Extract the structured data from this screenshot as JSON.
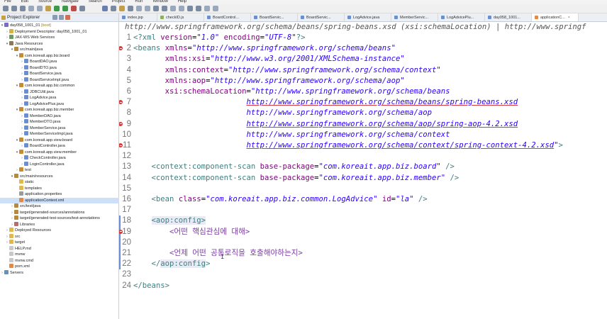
{
  "menubar": [
    "File",
    "Edit",
    "Source",
    "Navigate",
    "Search",
    "Project",
    "Run",
    "Window",
    "Help"
  ],
  "project_explorer": {
    "title": "Project Explorer",
    "tree": [
      {
        "label": "day058_1001_01",
        "suffix": " [boot]",
        "indent": 0,
        "arrow": "▾",
        "icon": "project-icon",
        "cls": "ic-proj"
      },
      {
        "label": "Deployment Descriptor: day058_1001_01",
        "indent": 1,
        "arrow": "›",
        "icon": "deployment-descriptor-icon",
        "cls": "ic-dd"
      },
      {
        "label": "JAX-WS Web Services",
        "indent": 1,
        "arrow": "›",
        "icon": "jaxws-icon",
        "cls": "ic-jaxws"
      },
      {
        "label": "Java Resources",
        "indent": 1,
        "arrow": "▾",
        "icon": "java-resources-icon",
        "cls": "ic-jres"
      },
      {
        "label": "src/main/java",
        "indent": 2,
        "arrow": "▾",
        "icon": "source-folder-icon",
        "cls": "ic-src"
      },
      {
        "label": "com.koreait.app.biz.board",
        "indent": 3,
        "arrow": "▾",
        "icon": "package-icon",
        "cls": "ic-pkg"
      },
      {
        "label": "BoardDAO.java",
        "indent": 4,
        "arrow": "›",
        "icon": "java-file-icon",
        "cls": "ic-java"
      },
      {
        "label": "BoardDTO.java",
        "indent": 4,
        "arrow": "›",
        "icon": "java-file-icon",
        "cls": "ic-java"
      },
      {
        "label": "BoardService.java",
        "indent": 4,
        "arrow": "›",
        "icon": "java-file-icon",
        "cls": "ic-java"
      },
      {
        "label": "BoardServiceImpl.java",
        "indent": 4,
        "arrow": "›",
        "icon": "java-file-icon",
        "cls": "ic-java"
      },
      {
        "label": "com.koreait.app.biz.common",
        "indent": 3,
        "arrow": "▾",
        "icon": "package-icon",
        "cls": "ic-pkg"
      },
      {
        "label": "JDBCUtil.java",
        "indent": 4,
        "arrow": "›",
        "icon": "java-file-icon",
        "cls": "ic-java"
      },
      {
        "label": "LogAdvice.java",
        "indent": 4,
        "arrow": "›",
        "icon": "java-file-icon",
        "cls": "ic-java"
      },
      {
        "label": "LogAdvicePlus.java",
        "indent": 4,
        "arrow": "›",
        "icon": "java-file-icon",
        "cls": "ic-java"
      },
      {
        "label": "com.koreait.app.biz.member",
        "indent": 3,
        "arrow": "▾",
        "icon": "package-icon",
        "cls": "ic-pkg"
      },
      {
        "label": "MemberDAO.java",
        "indent": 4,
        "arrow": "›",
        "icon": "java-file-icon",
        "cls": "ic-java"
      },
      {
        "label": "MemberDTO.java",
        "indent": 4,
        "arrow": "›",
        "icon": "java-file-icon",
        "cls": "ic-java"
      },
      {
        "label": "MemberService.java",
        "indent": 4,
        "arrow": "›",
        "icon": "java-file-icon",
        "cls": "ic-java"
      },
      {
        "label": "MemberServiceImpl.java",
        "indent": 4,
        "arrow": "›",
        "icon": "java-file-icon",
        "cls": "ic-java"
      },
      {
        "label": "com.koreait.app.view.board",
        "indent": 3,
        "arrow": "▾",
        "icon": "package-icon",
        "cls": "ic-pkg"
      },
      {
        "label": "BoardController.java",
        "indent": 4,
        "arrow": "›",
        "icon": "java-file-icon",
        "cls": "ic-java"
      },
      {
        "label": "com.koreait.app.view.member",
        "indent": 3,
        "arrow": "▾",
        "icon": "package-icon",
        "cls": "ic-pkg"
      },
      {
        "label": "CheckController.java",
        "indent": 4,
        "arrow": "›",
        "icon": "java-file-icon",
        "cls": "ic-java"
      },
      {
        "label": "LoginController.java",
        "indent": 4,
        "arrow": "›",
        "icon": "java-file-icon",
        "cls": "ic-java"
      },
      {
        "label": "test",
        "indent": 3,
        "arrow": "›",
        "icon": "package-icon",
        "cls": "ic-pkg"
      },
      {
        "label": "src/main/resources",
        "indent": 2,
        "arrow": "▾",
        "icon": "source-folder-icon",
        "cls": "ic-src"
      },
      {
        "label": "static",
        "indent": 3,
        "arrow": "",
        "icon": "folder-icon",
        "cls": "ic-fold"
      },
      {
        "label": "templates",
        "indent": 3,
        "arrow": "",
        "icon": "folder-icon",
        "cls": "ic-fold"
      },
      {
        "label": "application.properties",
        "indent": 3,
        "arrow": "",
        "icon": "properties-file-icon",
        "cls": "ic-prop"
      },
      {
        "label": "applicationContext.xml",
        "indent": 3,
        "arrow": "",
        "icon": "xml-file-icon",
        "cls": "ic-xml",
        "selected": true
      },
      {
        "label": "src/test/java",
        "indent": 2,
        "arrow": "›",
        "icon": "source-folder-icon",
        "cls": "ic-src"
      },
      {
        "label": "target/generated-sources/annotations",
        "indent": 2,
        "arrow": "›",
        "icon": "source-folder-icon",
        "cls": "ic-src"
      },
      {
        "label": "target/generated-test-sources/test-annotations",
        "indent": 2,
        "arrow": "›",
        "icon": "source-folder-icon",
        "cls": "ic-src"
      },
      {
        "label": "Libraries",
        "indent": 2,
        "arrow": "›",
        "icon": "libraries-icon",
        "cls": "ic-lib"
      },
      {
        "label": "Deployed Resources",
        "indent": 1,
        "arrow": "›",
        "icon": "folder-icon",
        "cls": "ic-fold"
      },
      {
        "label": "src",
        "indent": 1,
        "arrow": "›",
        "icon": "folder-icon",
        "cls": "ic-fold"
      },
      {
        "label": "target",
        "indent": 1,
        "arrow": "›",
        "icon": "folder-icon",
        "cls": "ic-fold"
      },
      {
        "label": "HELP.md",
        "indent": 1,
        "arrow": "",
        "icon": "file-icon",
        "cls": "ic-file"
      },
      {
        "label": "mvnw",
        "indent": 1,
        "arrow": "",
        "icon": "file-icon",
        "cls": "ic-file"
      },
      {
        "label": "mvnw.cmd",
        "indent": 1,
        "arrow": "",
        "icon": "file-icon",
        "cls": "ic-file"
      },
      {
        "label": "pom.xml",
        "indent": 1,
        "arrow": "",
        "icon": "xml-file-icon",
        "cls": "ic-xml"
      },
      {
        "label": "Servers",
        "indent": 0,
        "arrow": "›",
        "icon": "servers-icon",
        "cls": "ic-srv"
      }
    ]
  },
  "tabs": [
    {
      "label": "index.jsp",
      "kind": "java"
    },
    {
      "label": "checkID.js",
      "kind": "js"
    },
    {
      "label": "BoardControl...",
      "kind": "java"
    },
    {
      "label": "BoardServic...",
      "kind": "java"
    },
    {
      "label": "BoardServic...",
      "kind": "java"
    },
    {
      "label": "LogAdvice.java",
      "kind": "java"
    },
    {
      "label": "MemberServic...",
      "kind": "java"
    },
    {
      "label": "LogAdvicePlu...",
      "kind": "java"
    },
    {
      "label": "day058_1001...",
      "kind": "java"
    },
    {
      "label": "applicationC...",
      "kind": "xml",
      "active": true
    }
  ],
  "editor": {
    "hover_header": "http://www.springframework.org/schema/beans/spring-beans.xsd (xsi:schemaLocation) | http://www.springf",
    "lines": [
      {
        "n": "1",
        "err": false,
        "fold": "",
        "parts": [
          [
            "pi",
            "<?xml "
          ],
          [
            "attr",
            "version"
          ],
          [
            "txt",
            "="
          ],
          [
            "val",
            "\"1.0\""
          ],
          [
            "txt",
            " "
          ],
          [
            "attr",
            "encoding"
          ],
          [
            "txt",
            "="
          ],
          [
            "val",
            "\"UTF-8\""
          ],
          [
            "pi",
            "?>"
          ]
        ]
      },
      {
        "n": "2",
        "err": true,
        "fold": "⊖",
        "parts": [
          [
            "tag",
            "<beans "
          ],
          [
            "attr",
            "xmlns"
          ],
          [
            "txt",
            "="
          ],
          [
            "val",
            "\"http://www.springframework.org/schema/beans\""
          ]
        ]
      },
      {
        "n": "3",
        "err": false,
        "fold": "",
        "parts": [
          [
            "txt",
            "       "
          ],
          [
            "attr",
            "xmlns:xsi"
          ],
          [
            "txt",
            "="
          ],
          [
            "val",
            "\"http://www.w3.org/2001/XMLSchema-instance\""
          ]
        ]
      },
      {
        "n": "4",
        "err": false,
        "fold": "",
        "parts": [
          [
            "txt",
            "       "
          ],
          [
            "attr",
            "xmlns:context"
          ],
          [
            "txt",
            "="
          ],
          [
            "val",
            "\"http://www.springframework.org/schema/context\""
          ]
        ]
      },
      {
        "n": "5",
        "err": false,
        "fold": "",
        "parts": [
          [
            "txt",
            "       "
          ],
          [
            "attr",
            "xmlns:aop"
          ],
          [
            "txt",
            "="
          ],
          [
            "val",
            "\"http://www.springframework.org/schema/aop\""
          ]
        ]
      },
      {
        "n": "6",
        "err": false,
        "fold": "",
        "parts": [
          [
            "txt",
            "       "
          ],
          [
            "attr",
            "xsi:schemaLocation"
          ],
          [
            "txt",
            "="
          ],
          [
            "val",
            "\"http://www.springframework.org/schema/beans"
          ]
        ]
      },
      {
        "n": "7",
        "err": true,
        "fold": "",
        "parts": [
          [
            "txt",
            "                         "
          ],
          [
            "val und",
            "http://www.springframework.org/schema/beans/spring-beans.xsd"
          ]
        ]
      },
      {
        "n": "8",
        "err": false,
        "fold": "",
        "parts": [
          [
            "txt",
            "                         "
          ],
          [
            "val",
            "http://www.springframework.org/schema/aop"
          ]
        ]
      },
      {
        "n": "9",
        "err": true,
        "fold": "",
        "parts": [
          [
            "txt",
            "                         "
          ],
          [
            "val und",
            "http://www.springframework.org/schema/aop/spring-aop-4.2.xsd"
          ]
        ]
      },
      {
        "n": "10",
        "err": false,
        "fold": "",
        "parts": [
          [
            "txt",
            "                         "
          ],
          [
            "val",
            "http://www.springframework.org/schema/context"
          ]
        ]
      },
      {
        "n": "11",
        "err": true,
        "fold": "",
        "parts": [
          [
            "txt",
            "                         "
          ],
          [
            "val und",
            "http://www.springframework.org/schema/context/spring-context-4.2.xsd"
          ],
          [
            "val",
            "\""
          ],
          [
            "tag",
            ">"
          ]
        ]
      },
      {
        "n": "12",
        "err": false,
        "fold": "",
        "parts": []
      },
      {
        "n": "13",
        "err": false,
        "fold": "",
        "parts": [
          [
            "txt",
            "    "
          ],
          [
            "tag",
            "<context:component-scan "
          ],
          [
            "attr",
            "base-package"
          ],
          [
            "txt",
            "="
          ],
          [
            "val",
            "\"com.koreait.app.biz.board\""
          ],
          [
            "tag",
            " />"
          ]
        ]
      },
      {
        "n": "14",
        "err": false,
        "fold": "",
        "parts": [
          [
            "txt",
            "    "
          ],
          [
            "tag",
            "<context:component-scan "
          ],
          [
            "attr",
            "base-package"
          ],
          [
            "txt",
            "="
          ],
          [
            "val",
            "\"com.koreait.app.biz.member\""
          ],
          [
            "tag",
            " />"
          ]
        ]
      },
      {
        "n": "15",
        "err": false,
        "fold": "",
        "parts": []
      },
      {
        "n": "16",
        "err": false,
        "fold": "",
        "parts": [
          [
            "txt",
            "    "
          ],
          [
            "tag",
            "<bean "
          ],
          [
            "attr",
            "class"
          ],
          [
            "txt",
            "="
          ],
          [
            "val",
            "\"com.koreait.app.biz.common.LogAdvice\""
          ],
          [
            "txt",
            " "
          ],
          [
            "attr",
            "id"
          ],
          [
            "txt",
            "="
          ],
          [
            "val",
            "\"la\""
          ],
          [
            "tag",
            " />"
          ]
        ]
      },
      {
        "n": "17",
        "err": false,
        "fold": "",
        "parts": []
      },
      {
        "n": "18",
        "err": false,
        "fold": "⊖",
        "sel": true,
        "parts": [
          [
            "txt",
            "    "
          ],
          [
            "tag hl",
            "<aop:config>"
          ]
        ]
      },
      {
        "n": "19",
        "err": true,
        "fold": "",
        "sel": true,
        "parts": [
          [
            "txt",
            "        "
          ],
          [
            "cmt",
            "<어떤 핵심관심에 대해>"
          ]
        ]
      },
      {
        "n": "20",
        "err": false,
        "fold": "",
        "sel": true,
        "parts": []
      },
      {
        "n": "21",
        "err": false,
        "fold": "",
        "sel": true,
        "parts": [
          [
            "txt",
            "        "
          ],
          [
            "cmt",
            "<언제 어떤 공통로직을 호출해야하는지>"
          ]
        ]
      },
      {
        "n": "22",
        "err": false,
        "fold": "",
        "sel": true,
        "parts": [
          [
            "txt",
            "    "
          ],
          [
            "tag",
            "</"
          ],
          [
            "tag hl",
            "aop:config"
          ],
          [
            "tag",
            ">"
          ]
        ]
      },
      {
        "n": "23",
        "err": false,
        "fold": "",
        "parts": []
      },
      {
        "n": "24",
        "err": false,
        "fold": "",
        "parts": [
          [
            "tag",
            "</beans>"
          ]
        ]
      }
    ]
  },
  "colors": {
    "tag": "#3f7f7f",
    "attr": "#7f007f",
    "value": "#2a00ff",
    "error": "#d83a3a",
    "selection": "#cde0f7"
  }
}
